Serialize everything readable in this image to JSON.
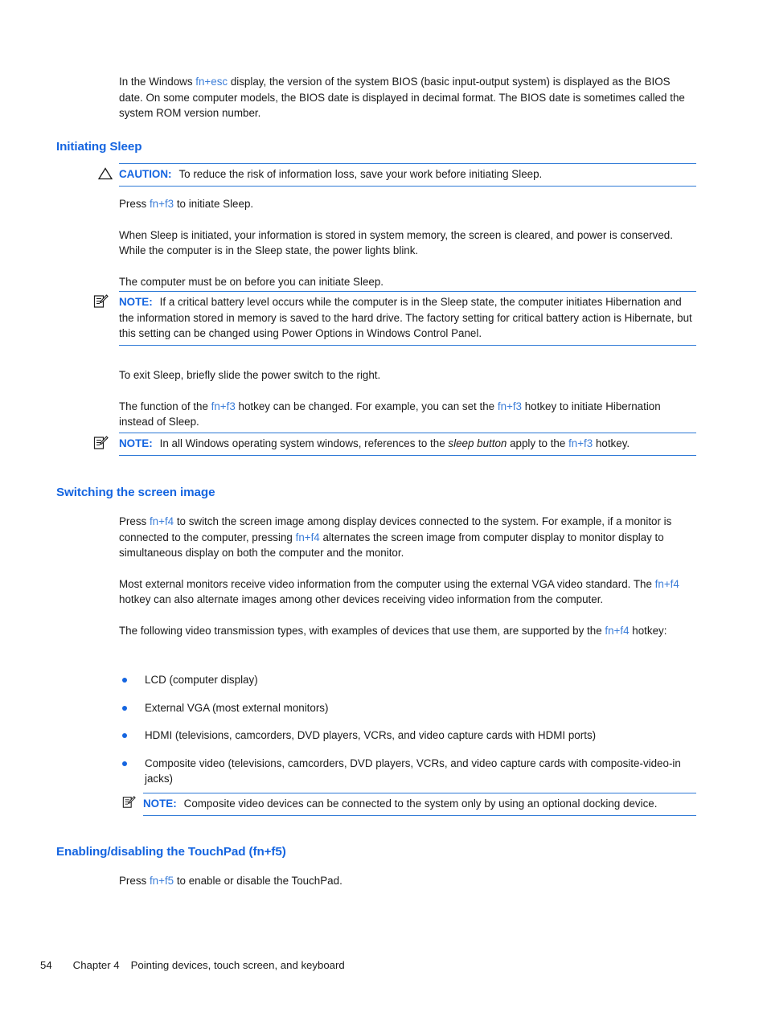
{
  "document": {
    "intro": {
      "before_key": "In the Windows ",
      "key": "fn+esc",
      "after_key": " display, the version of the system BIOS (basic input-output system) is displayed as the BIOS date. On some computer models, the BIOS date is displayed in decimal format. The BIOS date is sometimes called the system ROM version number."
    },
    "sections": [
      {
        "heading": "Initiating Sleep",
        "caution": {
          "icon": "warning-triangle-icon",
          "label": "CAUTION:",
          "text": "To reduce the risk of information loss, save your work before initiating Sleep."
        },
        "p_press_sleep": {
          "before_key": "Press ",
          "key": "fn+f3",
          "after_key": " to initiate Sleep."
        },
        "p_when_sleep": "When Sleep is initiated, your information is stored in system memory, the screen is cleared, and power is conserved. While the computer is in the Sleep state, the power lights blink.",
        "p_must_be_on": "The computer must be on before you can initiate Sleep.",
        "note_battery": {
          "icon": "note-pencil-icon",
          "label": "NOTE:",
          "text": "If a critical battery level occurs while the computer is in the Sleep state, the computer initiates Hibernation and the information stored in memory is saved to the hard drive. The factory setting for critical battery action is Hibernate, but this setting can be changed using Power Options in Windows Control Panel."
        },
        "p_exit_sleep": "To exit Sleep, briefly slide the power switch to the right.",
        "p_function": {
          "s1": "The function of the ",
          "k1": "fn+f3",
          "s2": " hotkey can be changed. For example, you can set the ",
          "k2": "fn+f3",
          "s3": " hotkey to initiate Hibernation instead of Sleep."
        },
        "note_sleepbutton": {
          "icon": "note-pencil-icon",
          "label": "NOTE:",
          "s1": "In all Windows operating system windows, references to the ",
          "italic": "sleep button",
          "s2": " apply to the ",
          "k1": "fn+f3",
          "s3": " hotkey."
        }
      },
      {
        "heading": "Switching the screen image",
        "p_press_f4": {
          "s1": "Press ",
          "k1": "fn+f4",
          "s2": " to switch the screen image among display devices connected to the system. For example, if a monitor is connected to the computer, pressing ",
          "k2": "fn+f4",
          "s3": " alternates the screen image from computer display to monitor display to simultaneous display on both the computer and the monitor."
        },
        "p_vga": {
          "s1": "Most external monitors receive video information from the computer using the external VGA video standard. The ",
          "k1": "fn+f4",
          "s2": " hotkey can also alternate images among other devices receiving video information from the computer."
        },
        "p_types": {
          "s1": "The following video transmission types, with examples of devices that use them, are supported by the ",
          "k1": "fn+f4",
          "s2": " hotkey:"
        },
        "bullets": [
          "LCD (computer display)",
          "External VGA (most external monitors)",
          "HDMI (televisions, camcorders, DVD players, VCRs, and video capture cards with HDMI ports)",
          "Composite video (televisions, camcorders, DVD players, VCRs, and video capture cards with composite-video-in jacks)"
        ],
        "note_composite": {
          "icon": "note-pencil-icon",
          "label": "NOTE:",
          "text": "Composite video devices can be connected to the system only by using an optional docking device."
        }
      },
      {
        "heading": "Enabling/disabling the TouchPad (fn+f5)",
        "p_press_f5": {
          "s1": "Press ",
          "k1": "fn+f5",
          "s2": " to enable or disable the TouchPad."
        }
      }
    ],
    "footer": {
      "page_number": "54",
      "chapter": "Chapter 4",
      "chapter_title": "Pointing devices, touch screen, and keyboard"
    },
    "colors": {
      "heading_blue": "#1565e0",
      "inline_key_blue": "#3b7dd8",
      "rule_blue": "#2f7ad6",
      "body_black": "#1a1a1a"
    }
  }
}
